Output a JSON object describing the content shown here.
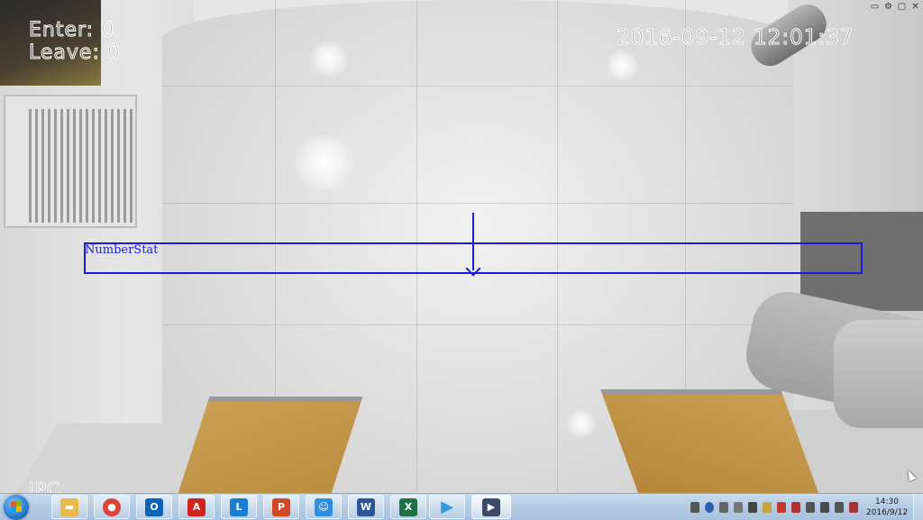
{
  "osd": {
    "enter_text": "Enter: 0",
    "leave_text": "Leave: 0",
    "timestamp": "2016-09-12 12:01:37",
    "brand": "IPC"
  },
  "counting_zone": {
    "label": "NumberStat",
    "line_color": "#1c1cd8",
    "direction": "down"
  },
  "window_controls": [
    {
      "icon": "screen-icon",
      "glyph": "▭"
    },
    {
      "icon": "settings-icon",
      "glyph": "⚙"
    },
    {
      "icon": "fullscreen-icon",
      "glyph": "▢"
    },
    {
      "icon": "close-icon",
      "glyph": "✕"
    }
  ],
  "taskbar": {
    "apps": [
      {
        "name": "file-explorer",
        "icon": "folder-icon",
        "glyph": "▬",
        "color": "#e8b84a"
      },
      {
        "name": "chrome",
        "icon": "chrome-icon",
        "glyph": "●",
        "color": "#db4437"
      },
      {
        "name": "outlook",
        "icon": "outlook-icon",
        "glyph": "O",
        "color": "#0a64b8"
      },
      {
        "name": "acrobat",
        "icon": "acrobat-icon",
        "glyph": "A",
        "color": "#d0231c"
      },
      {
        "name": "lync",
        "icon": "lync-icon",
        "glyph": "L",
        "color": "#1a7fd0"
      },
      {
        "name": "powerpoint",
        "icon": "powerpoint-icon",
        "glyph": "P",
        "color": "#d24726"
      },
      {
        "name": "contacts",
        "icon": "contacts-icon",
        "glyph": "☺",
        "color": "#2f8fe0"
      },
      {
        "name": "word",
        "icon": "word-icon",
        "glyph": "W",
        "color": "#2b5797"
      },
      {
        "name": "excel",
        "icon": "excel-icon",
        "glyph": "X",
        "color": "#1e7145"
      },
      {
        "name": "media-player",
        "icon": "play-icon",
        "glyph": "▶",
        "color": "#2b9be0"
      },
      {
        "name": "video-client",
        "icon": "video-icon",
        "glyph": "▶",
        "color": "#3b4a66"
      }
    ],
    "clock_time": "14:30",
    "clock_date": "2016/9/12"
  }
}
